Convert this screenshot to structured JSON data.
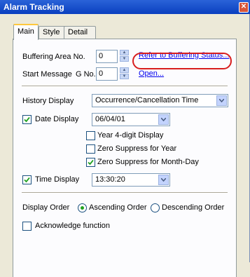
{
  "window": {
    "title": "Alarm Tracking",
    "close_glyph": "✕"
  },
  "tabs": [
    {
      "label": "Main",
      "active": true
    },
    {
      "label": "Style",
      "active": false
    },
    {
      "label": "Detail",
      "active": false
    }
  ],
  "buffering": {
    "label": "Buffering Area No.",
    "value": "0",
    "link": "Refer to Buffering Status..."
  },
  "start_message": {
    "label": "Start Message",
    "gno_label": "G No.",
    "value": "0",
    "link": "Open..."
  },
  "history_display": {
    "label": "History Display",
    "value": "Occurrence/Cancellation Time"
  },
  "date_display": {
    "label": "Date Display",
    "checked": true,
    "value": "06/04/01"
  },
  "date_options": [
    {
      "label": "Year 4-digit Display",
      "checked": false
    },
    {
      "label": "Zero Suppress for Year",
      "checked": false
    },
    {
      "label": "Zero Suppress for Month-Day",
      "checked": true
    }
  ],
  "time_display": {
    "label": "Time Display",
    "checked": true,
    "value": "13:30:20"
  },
  "display_order": {
    "label": "Display Order",
    "options": [
      {
        "label": "Ascending Order",
        "selected": true
      },
      {
        "label": "Descending Order",
        "selected": false
      }
    ]
  },
  "acknowledge": {
    "label": "Acknowledge function",
    "checked": false
  },
  "colors": {
    "highlight": "#d81e1e",
    "title_bar": "#0a3fbf",
    "radio_dot": "#21a121"
  }
}
